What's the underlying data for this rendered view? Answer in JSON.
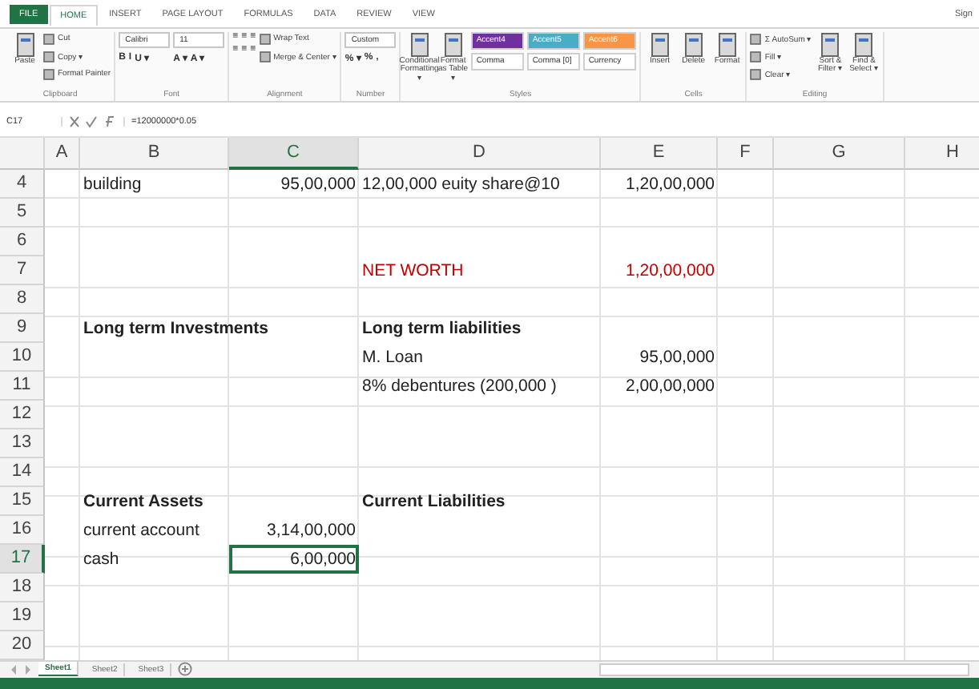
{
  "ribbon_tabs": [
    {
      "label": "FILE",
      "selected": false,
      "kind": "file"
    },
    {
      "label": "HOME",
      "selected": true,
      "kind": "tab"
    },
    {
      "label": "INSERT",
      "selected": false,
      "kind": "tab"
    },
    {
      "label": "PAGE LAYOUT",
      "selected": false,
      "kind": "tab"
    },
    {
      "label": "FORMULAS",
      "selected": false,
      "kind": "tab"
    },
    {
      "label": "DATA",
      "selected": false,
      "kind": "tab"
    },
    {
      "label": "REVIEW",
      "selected": false,
      "kind": "tab"
    },
    {
      "label": "VIEW",
      "selected": false,
      "kind": "tab"
    }
  ],
  "sign_in": "Sign",
  "groups": [
    {
      "label": "Clipboard",
      "columns": [
        [
          {
            "kind": "big",
            "text": "Paste"
          }
        ],
        [
          {
            "kind": "small",
            "text": "Cut"
          },
          {
            "kind": "small",
            "text": "Copy ▾"
          },
          {
            "kind": "small",
            "text": "Format Painter"
          }
        ]
      ]
    },
    {
      "label": "Font",
      "columns": [
        [
          {
            "kind": "field",
            "text": "Calibri"
          },
          {
            "kind": "glyphs",
            "items": [
              "B",
              "I",
              "U ▾"
            ]
          }
        ],
        [
          {
            "kind": "field",
            "text": "11"
          },
          {
            "kind": "glyphs",
            "items": [
              "A ▾",
              "A ▾"
            ]
          }
        ]
      ]
    },
    {
      "label": "Alignment",
      "columns": [
        [
          {
            "kind": "glyphs",
            "items": [
              "≡",
              "≡",
              "≡"
            ]
          },
          {
            "kind": "glyphs",
            "items": [
              "≡",
              "≡",
              "≡"
            ]
          }
        ],
        [
          {
            "kind": "small",
            "text": "Wrap Text"
          },
          {
            "kind": "small",
            "text": "Merge & Center ▾"
          }
        ]
      ]
    },
    {
      "label": "Number",
      "columns": [
        [
          {
            "kind": "field",
            "text": "Custom"
          },
          {
            "kind": "glyphs",
            "items": [
              "% ▾",
              "%",
              ","
            ]
          }
        ]
      ]
    },
    {
      "label": "Styles",
      "columns": [
        [
          {
            "kind": "big",
            "text": "Conditional Formatting ▾"
          }
        ],
        [
          {
            "kind": "big",
            "text": "Format as Table ▾"
          }
        ],
        [
          {
            "kind": "style",
            "text": "Accent4",
            "color": "#7030a0"
          },
          {
            "kind": "style",
            "text": "Comma",
            "color": "#ffffff"
          }
        ],
        [
          {
            "kind": "style",
            "text": "Accent5",
            "color": "#4bacc6"
          },
          {
            "kind": "style",
            "text": "Comma [0]",
            "color": "#ffffff"
          }
        ],
        [
          {
            "kind": "style",
            "text": "Accent6",
            "color": "#f79646"
          },
          {
            "kind": "style",
            "text": "Currency",
            "color": "#ffffff"
          }
        ]
      ]
    },
    {
      "label": "Cells",
      "columns": [
        [
          {
            "kind": "big",
            "text": "Insert"
          }
        ],
        [
          {
            "kind": "big",
            "text": "Delete"
          }
        ],
        [
          {
            "kind": "big",
            "text": "Format"
          }
        ]
      ]
    },
    {
      "label": "Editing",
      "columns": [
        [
          {
            "kind": "small",
            "text": "Σ AutoSum ▾"
          },
          {
            "kind": "small",
            "text": "Fill ▾"
          },
          {
            "kind": "small",
            "text": "Clear ▾"
          }
        ],
        [
          {
            "kind": "big",
            "text": "Sort & Filter ▾"
          }
        ],
        [
          {
            "kind": "big",
            "text": "Find & Select ▾"
          }
        ]
      ]
    }
  ],
  "name_box": "C17",
  "formula": "=12000000*0.05",
  "columns": [
    {
      "label": "A",
      "selected": false
    },
    {
      "label": "B",
      "selected": false
    },
    {
      "label": "C",
      "selected": true
    },
    {
      "label": "D",
      "selected": false
    },
    {
      "label": "E",
      "selected": false
    },
    {
      "label": "F",
      "selected": false
    },
    {
      "label": "G",
      "selected": false
    },
    {
      "label": "H",
      "selected": false
    }
  ],
  "rows": [
    {
      "label": "4",
      "selected": false,
      "cells": [
        null,
        {
          "text": "building",
          "kind": "text",
          "selected": false
        },
        {
          "text": "95,00,000",
          "kind": "number",
          "selected": false
        },
        {
          "text": "12,00,000 euity share@10",
          "kind": "text",
          "selected": false
        },
        {
          "text": "1,20,00,000",
          "kind": "number",
          "selected": false
        },
        null,
        null,
        null
      ]
    },
    {
      "label": "5",
      "selected": false,
      "cells": [
        null,
        null,
        null,
        null,
        null,
        null,
        null,
        null
      ]
    },
    {
      "label": "6",
      "selected": false,
      "cells": [
        null,
        null,
        null,
        null,
        null,
        null,
        null,
        null
      ]
    },
    {
      "label": "7",
      "selected": false,
      "cells": [
        null,
        null,
        null,
        {
          "text": "NET WORTH",
          "kind": "text",
          "selected": false,
          "color": "#c00000"
        },
        {
          "text": "1,20,00,000",
          "kind": "number",
          "selected": false,
          "color": "#c00000"
        },
        null,
        null,
        null
      ]
    },
    {
      "label": "8",
      "selected": false,
      "cells": [
        null,
        null,
        null,
        null,
        null,
        null,
        null,
        null
      ]
    },
    {
      "label": "9",
      "selected": false,
      "cells": [
        null,
        {
          "text": "Long term Investments",
          "kind": "text",
          "selected": false,
          "bold": true
        },
        null,
        {
          "text": "Long term liabilities",
          "kind": "text",
          "selected": false,
          "bold": true
        },
        null,
        null,
        null,
        null
      ]
    },
    {
      "label": "10",
      "selected": false,
      "cells": [
        null,
        null,
        null,
        {
          "text": "M. Loan",
          "kind": "text",
          "selected": false
        },
        {
          "text": "95,00,000",
          "kind": "number",
          "selected": false
        },
        null,
        null,
        null
      ]
    },
    {
      "label": "11",
      "selected": false,
      "cells": [
        null,
        null,
        null,
        {
          "text": "8% debentures (200,000 )",
          "kind": "text",
          "selected": false
        },
        {
          "text": "2,00,00,000",
          "kind": "number",
          "selected": false
        },
        null,
        null,
        null
      ]
    },
    {
      "label": "12",
      "selected": false,
      "cells": [
        null,
        null,
        null,
        null,
        null,
        null,
        null,
        null
      ]
    },
    {
      "label": "13",
      "selected": false,
      "cells": [
        null,
        null,
        null,
        null,
        null,
        null,
        null,
        null
      ]
    },
    {
      "label": "14",
      "selected": false,
      "cells": [
        null,
        null,
        null,
        null,
        null,
        null,
        null,
        null
      ]
    },
    {
      "label": "15",
      "selected": false,
      "cells": [
        null,
        {
          "text": "Current Assets",
          "kind": "text",
          "selected": false,
          "bold": true
        },
        null,
        {
          "text": "Current Liabilities",
          "kind": "text",
          "selected": false,
          "bold": true
        },
        null,
        null,
        null,
        null
      ]
    },
    {
      "label": "16",
      "selected": false,
      "cells": [
        null,
        {
          "text": "current account",
          "kind": "text",
          "selected": false
        },
        {
          "text": "3,14,00,000",
          "kind": "number",
          "selected": false
        },
        null,
        null,
        null,
        null,
        null
      ]
    },
    {
      "label": "17",
      "selected": true,
      "cells": [
        null,
        {
          "text": "cash",
          "kind": "text",
          "selected": false
        },
        {
          "text": "6,00,000",
          "kind": "number",
          "selected": true
        },
        null,
        null,
        null,
        null,
        null
      ]
    },
    {
      "label": "18",
      "selected": false,
      "cells": [
        null,
        null,
        null,
        null,
        null,
        null,
        null,
        null
      ]
    },
    {
      "label": "19",
      "selected": false,
      "cells": [
        null,
        null,
        null,
        null,
        null,
        null,
        null,
        null
      ]
    },
    {
      "label": "20",
      "selected": false,
      "cells": [
        null,
        null,
        null,
        null,
        null,
        null,
        null,
        null
      ]
    }
  ],
  "sheets": [
    {
      "label": "Sheet1",
      "selected": true
    },
    {
      "label": "Sheet2",
      "selected": false
    },
    {
      "label": "Sheet3",
      "selected": false
    }
  ]
}
